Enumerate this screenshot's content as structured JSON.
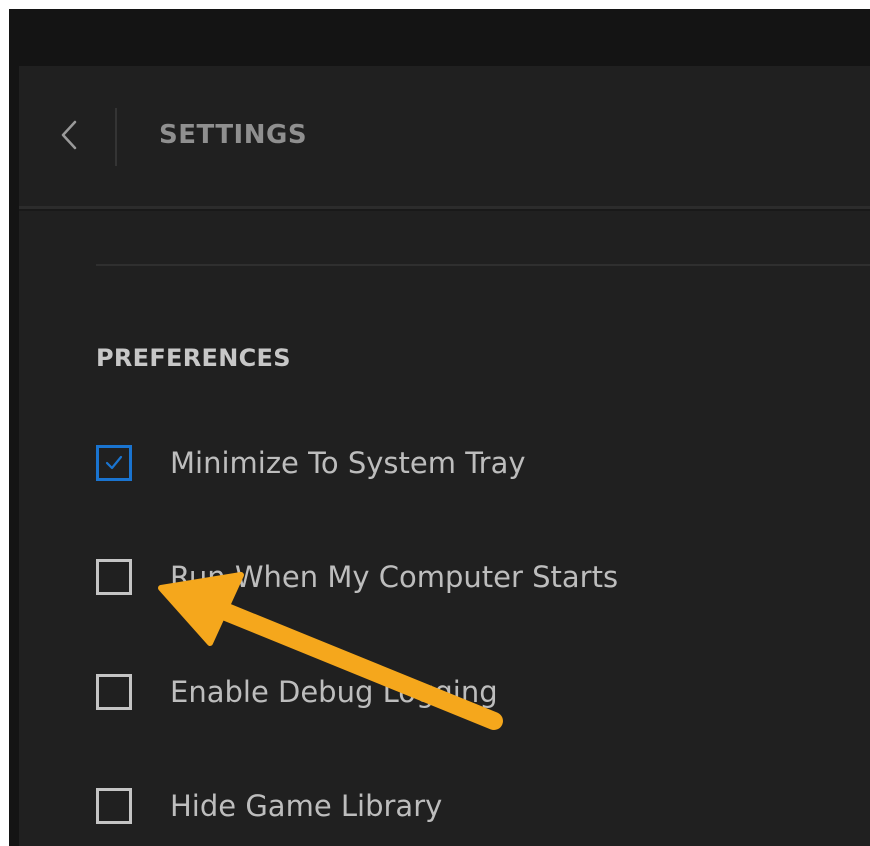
{
  "header": {
    "title": "SETTINGS",
    "back_icon": "chevron-left-icon"
  },
  "preferences": {
    "title": "PREFERENCES",
    "options": [
      {
        "label": "Minimize To System Tray",
        "checked": true
      },
      {
        "label": "Run When My Computer Starts",
        "checked": false
      },
      {
        "label": "Enable Debug Logging",
        "checked": false
      },
      {
        "label": "Hide Game Library",
        "checked": false
      }
    ]
  },
  "colors": {
    "app_background": "#202020",
    "checkbox_accent": "#1a74d0",
    "annotation_arrow": "#f5a71c"
  },
  "annotation": {
    "icon": "pointer-arrow-icon"
  }
}
